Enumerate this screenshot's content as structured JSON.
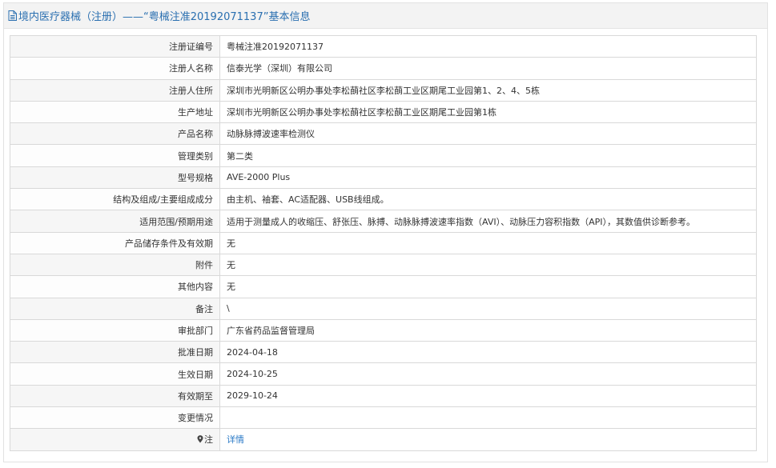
{
  "header": {
    "title": "境内医疗器械（注册）——“粤械注准20192071137”基本信息",
    "icon": "document-icon"
  },
  "rows": [
    {
      "label": "注册证编号",
      "value": "粤械注准20192071137"
    },
    {
      "label": "注册人名称",
      "value": "信泰光学（深圳）有限公司"
    },
    {
      "label": "注册人住所",
      "value": "深圳市光明新区公明办事处李松蓢社区李松蓢工业区期尾工业园第1、2、4、5栋"
    },
    {
      "label": "生产地址",
      "value": "深圳市光明新区公明办事处李松蓢社区李松蓢工业区期尾工业园第1栋"
    },
    {
      "label": "产品名称",
      "value": "动脉脉搏波速率检测仪"
    },
    {
      "label": "管理类别",
      "value": "第二类"
    },
    {
      "label": "型号规格",
      "value": "AVE-2000 Plus"
    },
    {
      "label": "结构及组成/主要组成成分",
      "value": "由主机、袖套、AC适配器、USB线组成。"
    },
    {
      "label": "适用范围/预期用途",
      "value": "适用于测量成人的收缩压、舒张压、脉搏、动脉脉搏波速率指数（AVI）、动脉压力容积指数（API），其数值供诊断参考。"
    },
    {
      "label": "产品储存条件及有效期",
      "value": "无"
    },
    {
      "label": "附件",
      "value": "无"
    },
    {
      "label": "其他内容",
      "value": "无"
    },
    {
      "label": "备注",
      "value": "\\"
    },
    {
      "label": "审批部门",
      "value": "广东省药品监督管理局"
    },
    {
      "label": "批准日期",
      "value": "2024-04-18"
    },
    {
      "label": "生效日期",
      "value": "2024-10-25"
    },
    {
      "label": "有效期至",
      "value": "2029-10-24"
    },
    {
      "label": "变更情况",
      "value": ""
    }
  ],
  "note_row": {
    "label": "注",
    "icon": "pin-icon",
    "link_text": "详情"
  },
  "colors": {
    "header_text": "#2a6fb0",
    "link": "#2a7ac7",
    "label_bg": "#f6f6f6",
    "border": "#d9d9d9"
  }
}
